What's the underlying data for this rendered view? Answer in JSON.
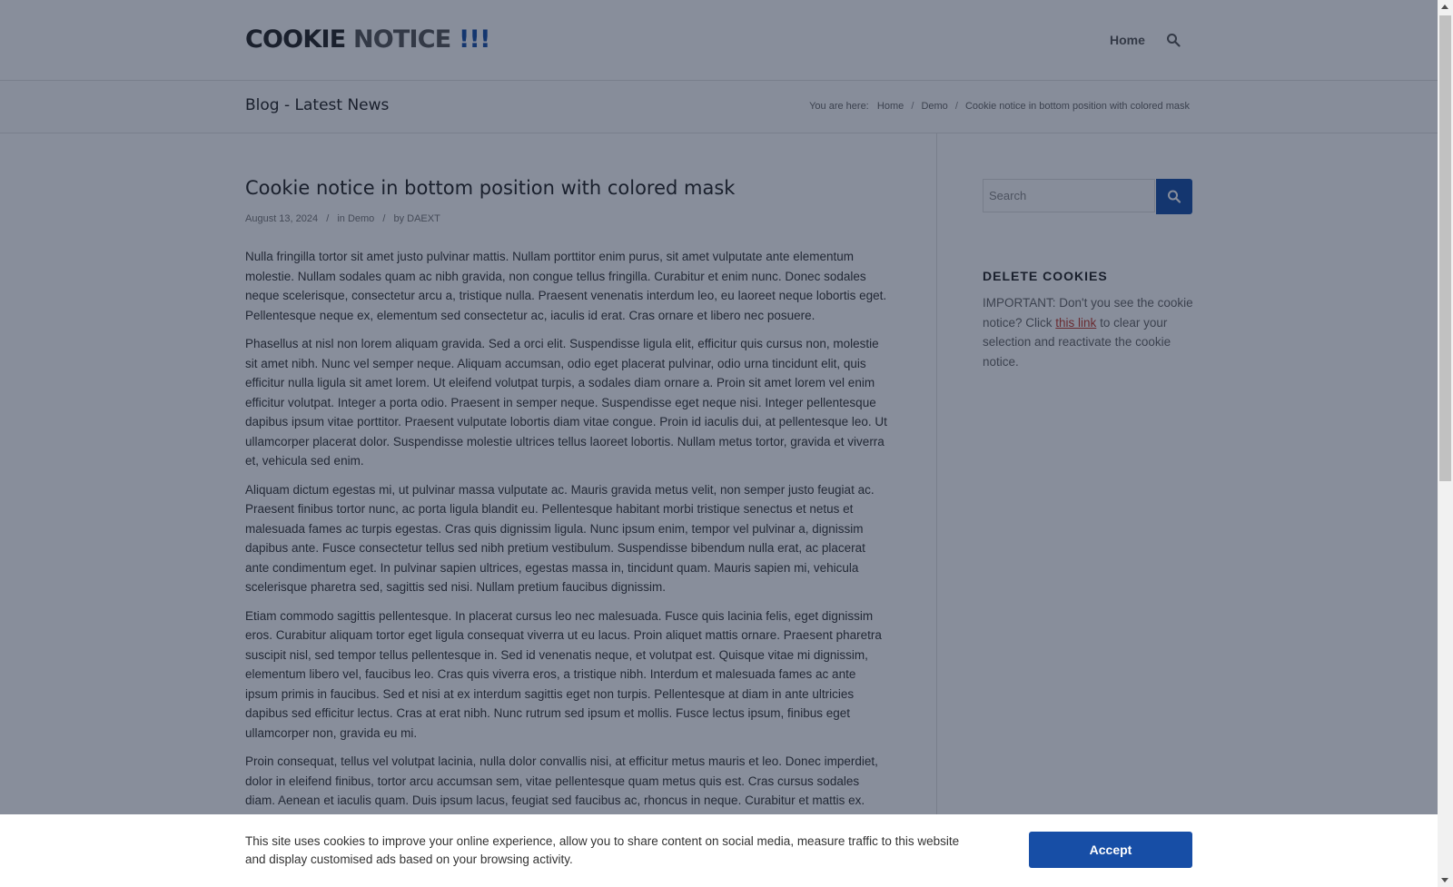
{
  "header": {
    "logo": {
      "word1": "COOKIE",
      "word2": "NOTICE",
      "word3": "!!!"
    },
    "nav": {
      "home": "Home",
      "search_icon": "search-icon"
    }
  },
  "titlebar": {
    "title": "Blog - Latest News",
    "breadcrumb": {
      "prefix": "You are here:",
      "items": [
        "Home",
        "Demo",
        "Cookie notice in bottom position with colored mask"
      ],
      "separator": "/"
    }
  },
  "post": {
    "title": "Cookie notice in bottom position with colored mask",
    "meta": {
      "date": "August 13, 2024",
      "category_prefix": "in",
      "category": "Demo",
      "author_prefix": "by",
      "author": "DAEXT"
    },
    "paragraphs": [
      "Nulla fringilla tortor sit amet justo pulvinar mattis. Nullam porttitor enim purus, sit amet vulputate ante elementum molestie. Nullam sodales quam ac nibh gravida, non congue tellus fringilla. Curabitur et enim nunc. Donec sodales neque scelerisque, consectetur arcu a, tristique nulla. Praesent venenatis interdum leo, eu laoreet neque lobortis eget. Pellentesque neque ex, elementum sed consectetur ac, iaculis id erat. Cras ornare et libero nec posuere.",
      "Phasellus at nisl non lorem aliquam gravida. Sed a orci elit. Suspendisse ligula elit, efficitur quis cursus non, molestie sit amet nibh. Nunc vel semper neque. Aliquam accumsan, odio eget placerat pulvinar, odio urna tincidunt elit, quis efficitur nulla ligula sit amet lorem. Ut eleifend volutpat turpis, a sodales diam ornare a. Proin sit amet lorem vel enim efficitur volutpat. Integer a porta odio. Praesent in semper neque. Suspendisse eget neque nisi. Integer pellentesque dapibus ipsum vitae porttitor. Praesent vulputate lobortis diam vitae congue. Proin id iaculis dui, at pellentesque leo. Ut ullamcorper placerat dolor. Suspendisse molestie ultrices tellus laoreet lobortis. Nullam metus tortor, gravida et viverra et, vehicula sed enim.",
      "Aliquam dictum egestas mi, ut pulvinar massa vulputate ac. Mauris gravida metus velit, non semper justo feugiat ac. Praesent finibus tortor nunc, ac porta ligula blandit eu. Pellentesque habitant morbi tristique senectus et netus et malesuada fames ac turpis egestas. Cras quis dignissim ligula. Nunc ipsum enim, tempor vel pulvinar a, dignissim dapibus ante. Fusce consectetur tellus sed nibh pretium vestibulum. Suspendisse bibendum nulla erat, ac placerat ante condimentum eget. In pulvinar sapien ultrices, egestas massa in, tincidunt quam. Mauris sapien mi, vehicula scelerisque pharetra sed, sagittis sed nisi. Nullam pretium faucibus dignissim.",
      "Etiam commodo sagittis pellentesque. In placerat cursus leo nec malesuada. Fusce quis lacinia felis, eget dignissim eros. Curabitur aliquam tortor eget ligula consequat viverra ut eu lacus. Proin aliquet mattis ornare. Praesent pharetra suscipit nisl, sed tempor tellus pellentesque in. Sed id venenatis neque, et volutpat est. Quisque vitae mi dignissim, elementum libero vel, faucibus leo. Cras quis viverra eros, a tristique nibh. Interdum et malesuada fames ac ante ipsum primis in faucibus. Sed et nisi at ex interdum sagittis eget non turpis. Pellentesque at diam in ante ultricies dapibus sed efficitur lectus. Cras at erat nibh. Nunc rutrum sed ipsum et mollis. Fusce lectus ipsum, finibus eget ullamcorper non, gravida eu mi.",
      "Proin consequat, tellus vel volutpat lacinia, nulla dolor convallis nisi, at efficitur metus mauris et leo. Donec imperdiet, dolor in eleifend finibus, tortor arcu accumsan sem, vitae pellentesque quam metus quis est. Cras cursus sodales diam. Aenean et iaculis quam. Duis ipsum lacus, feugiat sed faucibus ac, rhoncus in neque. Curabitur et mattis ex."
    ]
  },
  "sidebar": {
    "search_placeholder": "Search",
    "search_button_icon": "search-icon",
    "widget": {
      "title": "DELETE COOKIES",
      "text_before": "IMPORTANT: Don't you see the cookie notice? Click ",
      "link": "this link",
      "text_after": " to clear your selection and reactivate the cookie notice."
    }
  },
  "cookie_notice": {
    "text": "This site uses cookies to improve your online experience, allow you to share content on social media, measure traffic to this website and display customised ads based on your browsing activity.",
    "accept_label": "Accept"
  },
  "colors": {
    "accent": "#174ea6",
    "mask": "rgba(17,30,55,0.5)",
    "link": "#c0392b"
  }
}
